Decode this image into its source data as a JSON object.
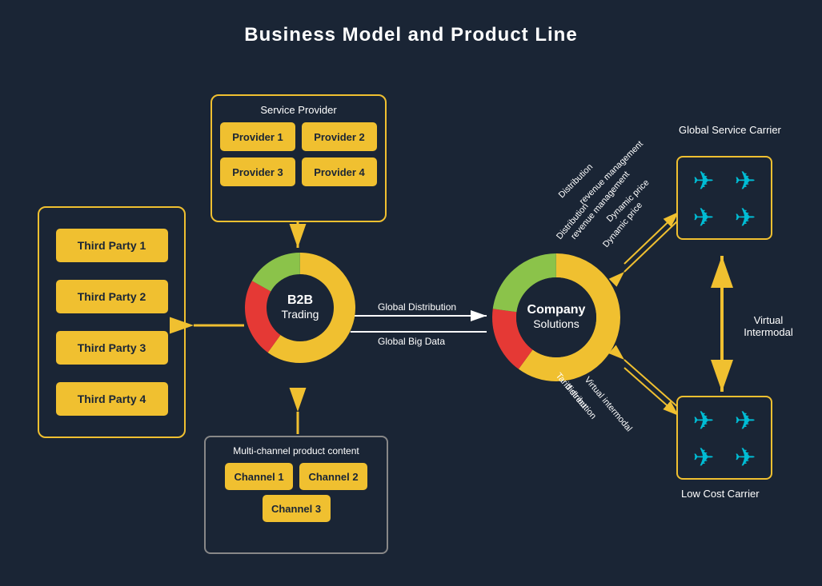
{
  "title": "Business Model and Product Line",
  "thirdParty": {
    "label": "Third Party",
    "items": [
      "Third Party 1",
      "Third Party 2",
      "Third Party 3",
      "Third Party 4"
    ]
  },
  "serviceProvider": {
    "label": "Service Provider",
    "items": [
      "Provider 1",
      "Provider 2",
      "Provider 3",
      "Provider 4"
    ]
  },
  "b2bTrading": {
    "label": "B2B\nTrading"
  },
  "companySolutions": {
    "label": "Company\nSolutions"
  },
  "multiChannel": {
    "label": "Multi-channel product content",
    "channels": [
      "Channel 1",
      "Channel 2",
      "Channel 3"
    ]
  },
  "globalServiceCarrier": {
    "label": "Global Service\nCarrier"
  },
  "lowCostCarrier": {
    "label": "Low Cost\nCarrier"
  },
  "virtualIntermodal": {
    "label": "Virtual\nIntermodal"
  },
  "arrows": {
    "globalDistribution": "Global Distribution",
    "globalBigData": "Global Big Data",
    "distribution": "Distribution",
    "revenueManagement": "revenue management",
    "dynamicPrice": "Dynamic price",
    "tariffDirect": "Tariff direct\ndistribution",
    "virtualIntermodalLabel": "Virtual intermodal"
  }
}
